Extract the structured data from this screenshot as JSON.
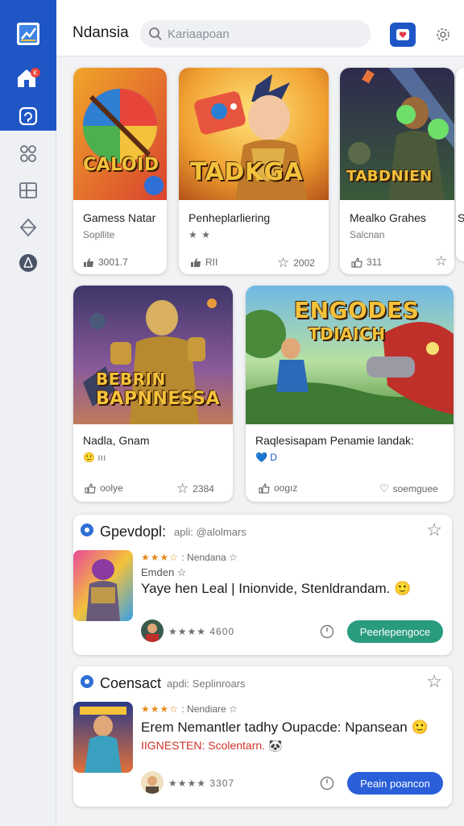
{
  "app": {
    "title": "Ndansia"
  },
  "search": {
    "placeholder": "Kariaapoan"
  },
  "colors": {
    "sidebar_active": "#1e56c6",
    "cta_teal": "#2a9c7e",
    "cta_blue": "#2b5fd9",
    "rating_orange": "#e68a1c"
  },
  "sidebar": {
    "items": [
      {
        "icon": "chart-board-icon"
      },
      {
        "icon": "home-icon"
      },
      {
        "icon": "chat-icon"
      },
      {
        "icon": "group-icon"
      },
      {
        "icon": "grid-icon"
      },
      {
        "icon": "pin-icon"
      },
      {
        "icon": "network-icon"
      }
    ]
  },
  "top_games": [
    {
      "title": "Gamess Natar",
      "subtitle": "Sopllite",
      "likes": "3001.7",
      "art_text": "CALOID"
    },
    {
      "title": "Penheplarliering",
      "subtitle": "★ ★",
      "likes": "RII",
      "stars": "2002",
      "art_text": "TADKGA"
    },
    {
      "title": "Mealko Grahes",
      "subtitle": "Salcnan",
      "likes": "311",
      "art_text": "TABDNIEN"
    },
    {
      "title": "S"
    }
  ],
  "mid_games": [
    {
      "title": "Nadla, Gnam",
      "subtitle": "🙂 ııı",
      "likes": "oolye",
      "stars": "2384",
      "art_text_1": "BEBRIN",
      "art_text_2": "BAPNNESSA"
    },
    {
      "title": "Raqlesisapam Penamie landak:",
      "subtitle": "💙 D",
      "likes": "oogız",
      "saves": "soemguee",
      "art_text_1": "ENGODES",
      "art_text_2": "TDIAICH"
    }
  ],
  "posts": [
    {
      "author": "Gpevdopl:",
      "meta": "apli: @alolmars",
      "rating_stars": "★★★☆",
      "rating_label": ": Nendana ☆",
      "sub": "Emden ☆",
      "body": "Yaye hen Leal | Inionvide, Stenldrandam. 🙂",
      "footer_rating": "★★★★ 4600",
      "cta": "Peerlepengoce"
    },
    {
      "author": "Coensact",
      "meta": "apdi: Seplinroars",
      "rating_stars": "★★★☆",
      "rating_label": ": Nendiare ☆",
      "body": "Erem Nemantler tadhy Oupacde: Npansean 🙂",
      "highlight": "IIGNESTEN: Scolentarn. 🐼",
      "footer_rating": "★★★★ 3307",
      "cta": "Peain poancon"
    }
  ]
}
